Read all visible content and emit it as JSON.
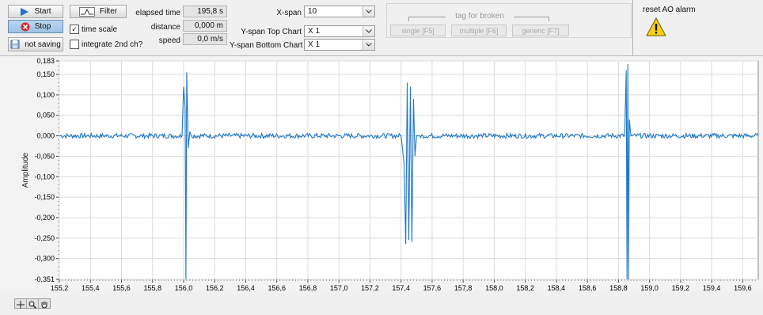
{
  "toolbar": {
    "start_label": "Start",
    "stop_label": "Stop",
    "not_saving_label": "not saving",
    "filter_label": "Filter",
    "time_scale_label": "time scale",
    "time_scale_checked": true,
    "integrate_label": "integrate 2nd ch?",
    "integrate_checked": false
  },
  "readouts": {
    "elapsed_label": "elapsed time",
    "elapsed_value": "195,8 s",
    "distance_label": "distance",
    "distance_value": "0,000 m",
    "speed_label": "speed",
    "speed_value": "0,0 m/s"
  },
  "spans": {
    "xspan_label": "X-span",
    "xspan_value": "10",
    "ytop_label": "Y-span Top Chart",
    "ytop_value": "X 1",
    "ybottom_label": "Y-span Bottom Chart",
    "ybottom_value": "X 1"
  },
  "tagging": {
    "title": "tag for broken",
    "single_label": "single [F5]",
    "multiple_label": "multiple [F6]",
    "generic_label": "generic [F7]"
  },
  "alarm": {
    "label": "reset AO alarm",
    "icon": "warning-icon"
  },
  "palette_icons": [
    "crosshair-icon",
    "zoom-icon",
    "pan-hand-icon"
  ],
  "chart_data": {
    "type": "line",
    "xlabel": "",
    "ylabel": "Amplitude",
    "xlim": [
      155.2,
      159.7
    ],
    "ylim": [
      -0.351,
      0.183
    ],
    "x_ticks": [
      "155,2",
      "155,4",
      "155,6",
      "155,8",
      "156,0",
      "156,2",
      "156,4",
      "156,6",
      "156,8",
      "157,0",
      "157,2",
      "157,4",
      "157,6",
      "157,8",
      "158,0",
      "158,2",
      "158,4",
      "158,6",
      "158,8",
      "159,0",
      "159,2",
      "159,4",
      "159,6"
    ],
    "y_ticks": [
      "0,183",
      "0,150",
      "0,100",
      "0,050",
      "0,000",
      "-0,050",
      "-0,100",
      "-0,150",
      "-0,200",
      "-0,250",
      "-0,300",
      "-0,351"
    ],
    "grid": true,
    "color": "#1f78c8",
    "baseline_noise": 0.006,
    "series": [
      {
        "values_note": "",
        "x": [
          155.2,
          155.99,
          156.0,
          156.01,
          156.015,
          156.02,
          156.025,
          156.03,
          156.04,
          156.05,
          157.4,
          157.42,
          157.43,
          157.44,
          157.45,
          157.46,
          157.47,
          157.48,
          157.49,
          157.5,
          157.52,
          158.84,
          158.85,
          158.855,
          158.86,
          158.865,
          158.87,
          158.88,
          159.7
        ],
        "y": [
          0.0,
          0.0,
          0.12,
          0.07,
          -0.351,
          0.155,
          0.06,
          -0.03,
          0.01,
          0.0,
          0.0,
          -0.07,
          -0.265,
          0.13,
          -0.255,
          0.12,
          -0.26,
          0.09,
          -0.05,
          0.0,
          0.0,
          0.0,
          0.16,
          -0.351,
          0.175,
          -0.351,
          0.04,
          0.0,
          0.0
        ]
      }
    ]
  }
}
